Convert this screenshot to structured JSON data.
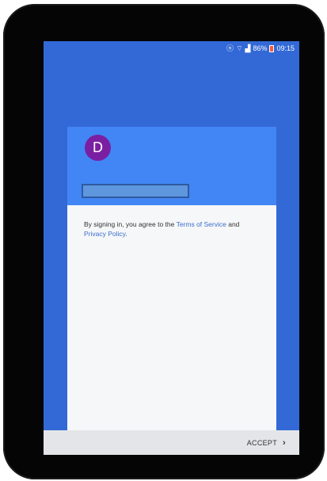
{
  "status_bar": {
    "icons": [
      "mute-icon",
      "wifi-icon",
      "signal-icon",
      "battery-icon"
    ],
    "battery": "86%",
    "time": "09:15"
  },
  "account": {
    "avatar_letter": "D",
    "avatar_color": "#7b1fa2"
  },
  "terms": {
    "prefix": "By signing in, you agree to the ",
    "tos_link": "Terms of Service",
    "middle": " and ",
    "privacy_link": "Privacy Policy",
    "suffix": "."
  },
  "footer": {
    "accept_label": "ACCEPT",
    "chevron": "›"
  },
  "colors": {
    "screen_bg": "#3369d6",
    "header": "#4285f4",
    "link": "#3a6fd0"
  }
}
